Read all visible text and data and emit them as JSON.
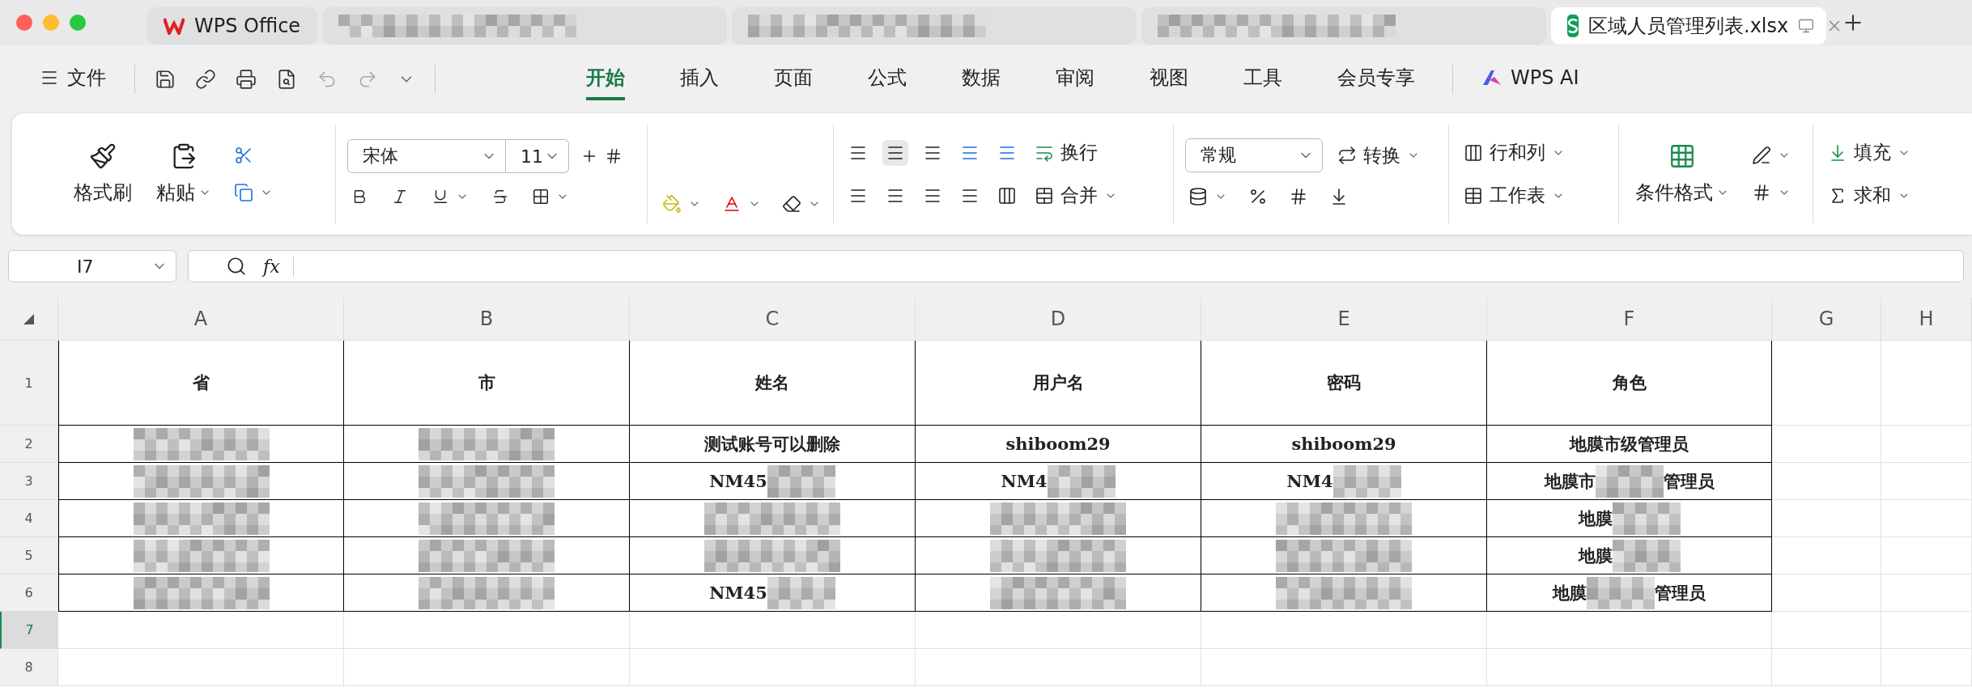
{
  "tabs": [
    {
      "kind": "app",
      "label": "WPS Office",
      "selected": false
    },
    {
      "kind": "redacted",
      "selected": false
    },
    {
      "kind": "redacted",
      "selected": false
    },
    {
      "kind": "redacted",
      "selected": false
    },
    {
      "kind": "file",
      "label": "区域人员管理列表.xlsx",
      "selected": true
    }
  ],
  "menu": {
    "file_label": "文件",
    "items": [
      {
        "label": "开始",
        "selected": true
      },
      {
        "label": "插入",
        "selected": false
      },
      {
        "label": "页面",
        "selected": false
      },
      {
        "label": "公式",
        "selected": false
      },
      {
        "label": "数据",
        "selected": false
      },
      {
        "label": "审阅",
        "selected": false
      },
      {
        "label": "视图",
        "selected": false
      },
      {
        "label": "工具",
        "selected": false
      },
      {
        "label": "会员专享",
        "selected": false
      }
    ],
    "ai_label": "WPS AI"
  },
  "ribbon": {
    "format_painter": "格式刷",
    "paste": "粘贴",
    "font": "宋体",
    "font_size": "11",
    "wrap": "换行",
    "merge": "合并",
    "number_format": "常规",
    "convert": "转换",
    "rows_cols": "行和列",
    "worksheet": "工作表",
    "conditional_format": "条件格式",
    "fill": "填充",
    "sum": "求和"
  },
  "name_box": "I7",
  "fx_label": "fx",
  "sheet": {
    "columns": [
      {
        "label": "A"
      },
      {
        "label": "B"
      },
      {
        "label": "C"
      },
      {
        "label": "D"
      },
      {
        "label": "E"
      },
      {
        "label": "F"
      },
      {
        "label": "G"
      },
      {
        "label": "H"
      }
    ],
    "rows": [
      {
        "label": "1",
        "selected": false,
        "cells": [
          {
            "text": "省"
          },
          {
            "text": "市"
          },
          {
            "text": "姓名"
          },
          {
            "text": "用户名"
          },
          {
            "text": "密码"
          },
          {
            "text": "角色"
          }
        ]
      },
      {
        "label": "2",
        "selected": false,
        "cells": [
          {
            "redacted": true
          },
          {
            "redacted": true
          },
          {
            "text": "测试账号可以删除"
          },
          {
            "text": "shiboom29"
          },
          {
            "text": "shiboom29"
          },
          {
            "text": "地膜市级管理员"
          }
        ]
      },
      {
        "label": "3",
        "selected": false,
        "cells": [
          {
            "redacted": true
          },
          {
            "redacted": true
          },
          {
            "text": "NM45",
            "redacted": true
          },
          {
            "text": "NM4",
            "redacted": true
          },
          {
            "text": "NM4",
            "redacted": true
          },
          {
            "text": "地膜市",
            "after": "管理员",
            "redacted": true
          }
        ]
      },
      {
        "label": "4",
        "selected": false,
        "cells": [
          {
            "redacted": true
          },
          {
            "redacted": true
          },
          {
            "redacted": true
          },
          {
            "redacted": true
          },
          {
            "redacted": true
          },
          {
            "text": "地膜",
            "redacted": true
          }
        ]
      },
      {
        "label": "5",
        "selected": false,
        "cells": [
          {
            "redacted": true
          },
          {
            "redacted": true
          },
          {
            "redacted": true
          },
          {
            "redacted": true
          },
          {
            "redacted": true
          },
          {
            "text": "地膜",
            "redacted": true
          }
        ]
      },
      {
        "label": "6",
        "selected": false,
        "cells": [
          {
            "redacted": true
          },
          {
            "redacted": true
          },
          {
            "text": "NM45",
            "redacted": true
          },
          {
            "redacted": true
          },
          {
            "redacted": true
          },
          {
            "text": "地膜",
            "after": "管理员",
            "redacted": true
          }
        ]
      },
      {
        "label": "7",
        "selected": true
      },
      {
        "label": "8",
        "selected": false
      }
    ]
  }
}
